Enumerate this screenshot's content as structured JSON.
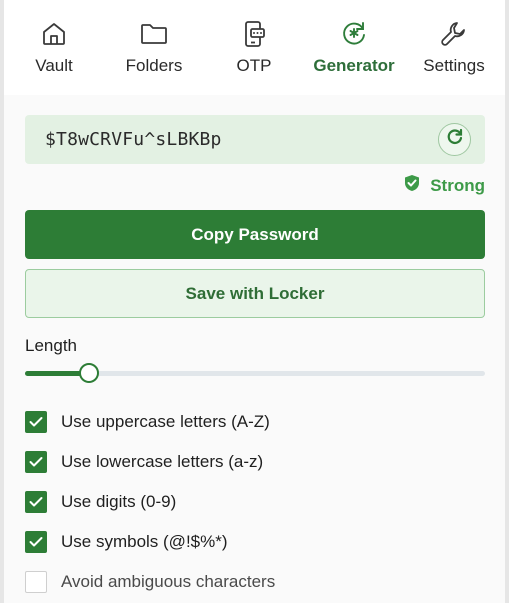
{
  "nav": {
    "items": [
      {
        "label": "Vault",
        "icon": "home-icon"
      },
      {
        "label": "Folders",
        "icon": "folder-icon"
      },
      {
        "label": "OTP",
        "icon": "phone-otp-icon"
      },
      {
        "label": "Generator",
        "icon": "generator-refresh-icon",
        "active": true
      },
      {
        "label": "Settings",
        "icon": "wrench-icon"
      }
    ]
  },
  "generator": {
    "password": "$T8wCRVFu^sLBKBp",
    "strength": "Strong",
    "copy_label": "Copy Password",
    "save_label": "Save with Locker",
    "length_label": "Length",
    "length_fraction": 0.14,
    "options": [
      {
        "label": "Use uppercase letters (A-Z)",
        "checked": true
      },
      {
        "label": "Use lowercase letters (a-z)",
        "checked": true
      },
      {
        "label": "Use digits (0-9)",
        "checked": true
      },
      {
        "label": "Use symbols (@!$%*)",
        "checked": true
      },
      {
        "label": "Avoid ambiguous characters",
        "checked": false
      }
    ]
  },
  "colors": {
    "accent": "#2d7d36",
    "strong": "#3d9a48",
    "password_bg": "#e3f1e3"
  }
}
